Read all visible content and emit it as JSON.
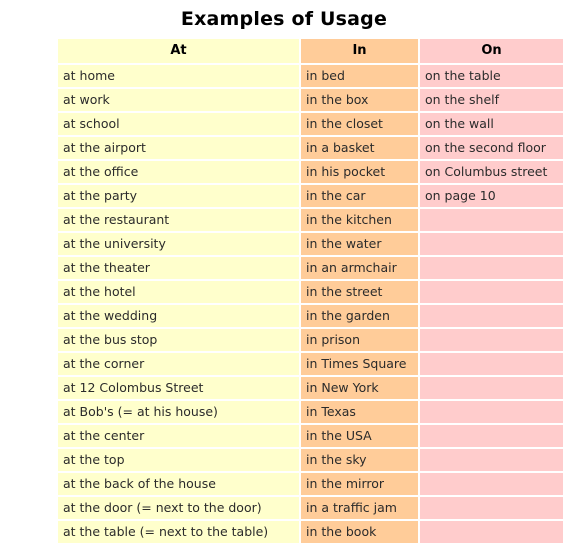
{
  "page": {
    "title": "Examples of Usage"
  },
  "colors": {
    "at_column": "#ffffcc",
    "in_column": "#ffcc99",
    "on_column": "#ffcccc",
    "text": "#2b2b2b",
    "background": "#ffffff"
  },
  "table": {
    "headers": [
      "At",
      "In",
      "On"
    ],
    "rows": [
      {
        "at": "at home",
        "in": "in bed",
        "on": "on the table"
      },
      {
        "at": "at work",
        "in": "in the box",
        "on": "on the shelf"
      },
      {
        "at": "at school",
        "in": "in the closet",
        "on": "on the wall"
      },
      {
        "at": "at the airport",
        "in": "in a basket",
        "on": "on the second floor"
      },
      {
        "at": "at the office",
        "in": "in his pocket",
        "on": "on Columbus street"
      },
      {
        "at": "at the party",
        "in": "in the car",
        "on": "on page 10"
      },
      {
        "at": "at the restaurant",
        "in": "in the kitchen",
        "on": ""
      },
      {
        "at": "at the university",
        "in": "in the water",
        "on": ""
      },
      {
        "at": "at the theater",
        "in": "in an armchair",
        "on": ""
      },
      {
        "at": "at the hotel",
        "in": "in the street",
        "on": ""
      },
      {
        "at": "at the wedding",
        "in": "in the garden",
        "on": ""
      },
      {
        "at": "at the bus stop",
        "in": "in prison",
        "on": ""
      },
      {
        "at": "at the corner",
        "in": "in Times Square",
        "on": ""
      },
      {
        "at": "at 12 Colombus Street",
        "in": "in New York",
        "on": ""
      },
      {
        "at": "at Bob's (= at his house)",
        "in": "in Texas",
        "on": ""
      },
      {
        "at": "at the center",
        "in": "in the USA",
        "on": ""
      },
      {
        "at": "at the top",
        "in": "in the sky",
        "on": ""
      },
      {
        "at": "at the back of the house",
        "in": "in the mirror",
        "on": ""
      },
      {
        "at": "at the door (= next to the door)",
        "in": "in a traffic jam",
        "on": ""
      },
      {
        "at": "at the table (= next to the table)",
        "in": "in the book",
        "on": ""
      }
    ]
  }
}
